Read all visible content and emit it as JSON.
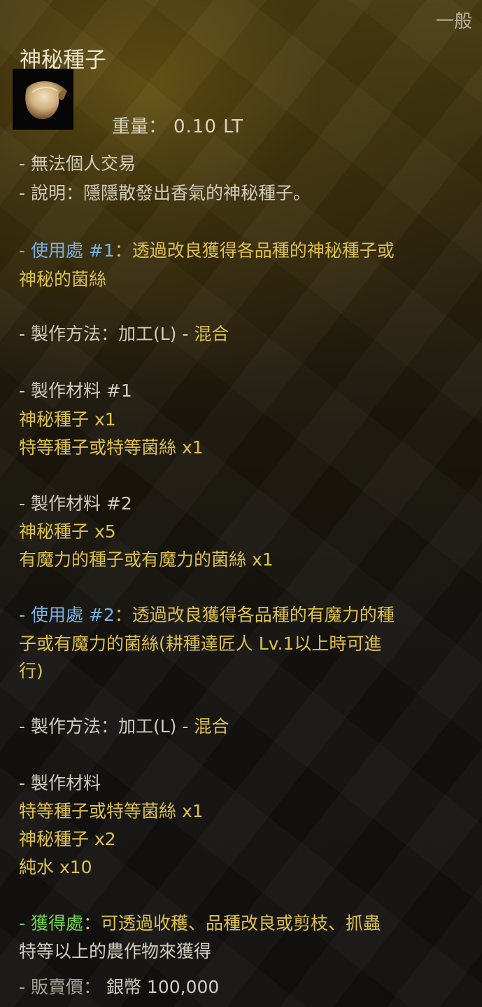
{
  "grade": "一般",
  "item_name": "神秘種子",
  "icon": "mysterious-seed-icon",
  "weight": {
    "label": "重量：",
    "value": "0.10 LT"
  },
  "untradeable": "- 無法個人交易",
  "description": "- 說明：隱隱散發出香氣的神秘種子。",
  "use1": {
    "prefix": "- 使用處 #1",
    "line1": "：透過改良獲得各品種的神秘種子或",
    "line2": "神秘的菌絲"
  },
  "method1": {
    "label": "- 製作方法：加工(L) - ",
    "value": "混合"
  },
  "materials1": {
    "header": "- 製作材料 #1",
    "items": [
      "神秘種子 x1",
      "特等種子或特等菌絲 x1"
    ]
  },
  "materials2": {
    "header": "- 製作材料 #2",
    "items": [
      "神秘種子 x5",
      "有魔力的種子或有魔力的菌絲 x1"
    ]
  },
  "use2": {
    "prefix": "- 使用處 #2",
    "line1": "：透過改良獲得各品種的有魔力的種",
    "line2": "子或有魔力的菌絲(耕種達匠人 Lv.1以上時可進",
    "line3": "行)"
  },
  "method2": {
    "label": "- 製作方法：加工(L) - ",
    "value": "混合"
  },
  "materials3": {
    "header": "- 製作材料",
    "items": [
      "特等種子或特等菌絲 x1",
      "神秘種子 x2",
      "純水 x10"
    ]
  },
  "obtain": {
    "prefix": "- 獲得處",
    "line1": "：可透過收穫、品種改良或剪枝、抓蟲",
    "line2": "特等以上的農作物來獲得"
  },
  "sell_price": {
    "label": "- 販賣價：",
    "value": "銀幣 100,000"
  },
  "colors": {
    "gold_text": "#dcc04a",
    "blue_text": "#79b2e6",
    "green_text": "#6fd24f",
    "white_text": "#d0ccbd"
  }
}
